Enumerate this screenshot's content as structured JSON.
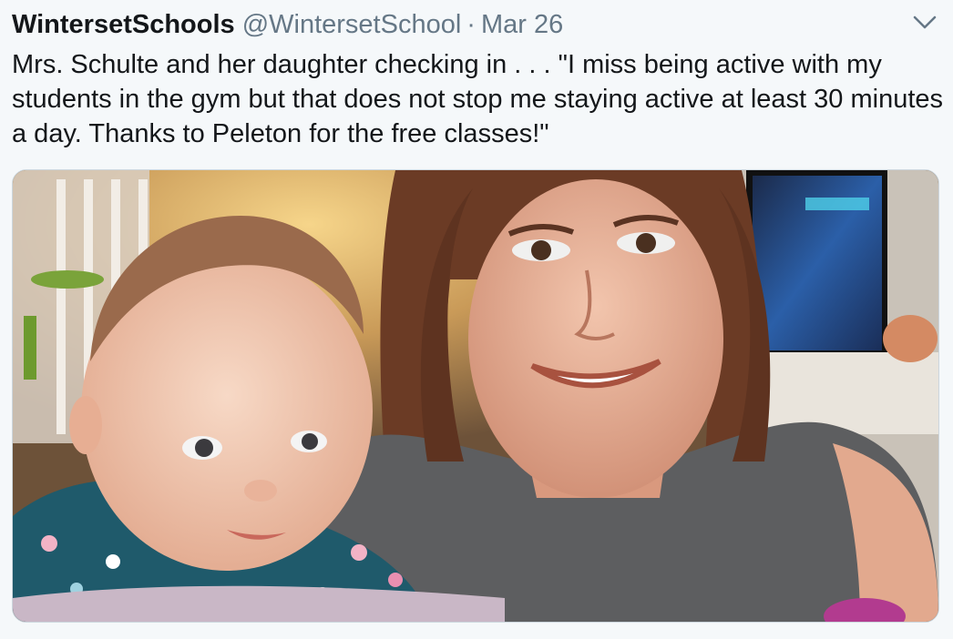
{
  "tweet": {
    "display_name": "WintersetSchools",
    "handle": "@WintersetSchool",
    "separator": "·",
    "date": "Mar 26",
    "text": "Mrs. Schulte and her daughter checking in . . . \"I miss being active with my students in the gym but that does not stop me staying active at least 30 minutes a day. Thanks to Peleton for the free classes!\"",
    "caret_icon": "chevron-down-icon",
    "photo_icon": "photo-selfie"
  },
  "colors": {
    "text": "#14171a",
    "secondary": "#657786",
    "background": "#f5f8fa"
  }
}
